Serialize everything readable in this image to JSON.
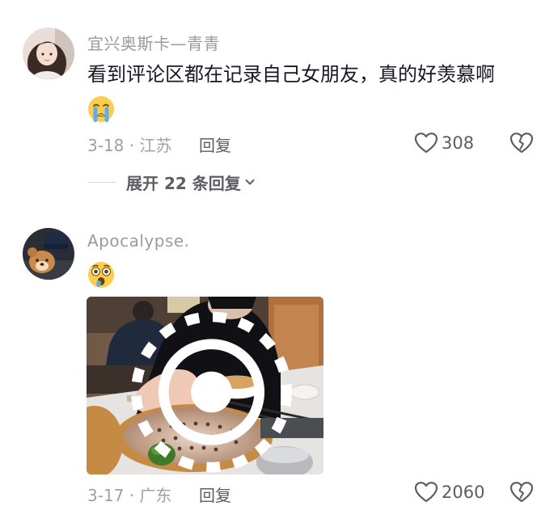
{
  "comments": [
    {
      "username": "宜兴奥斯卡—青青",
      "text": "看到评论区都在记录自己女朋友，真的好羡慕啊",
      "emoji": "loudly-crying-face",
      "date_location": "3-18 · 江苏",
      "reply_label": "回复",
      "like_count": "308",
      "expand_replies": "展开 22 条回复"
    },
    {
      "username": "Apocalypse.",
      "emoji": "astonished-face",
      "date_location": "3-17 · 广东",
      "reply_label": "回复",
      "like_count": "2060",
      "image": "photo-dumplings-steamer"
    }
  ],
  "colors": {
    "primary_text": "#161823",
    "secondary_text": "#9a9aa0",
    "action_text": "#5c5c63"
  },
  "icons": {
    "like": "heart-outline-icon",
    "dislike": "broken-heart-icon",
    "expand": "chevron-down-icon",
    "live_photo": "live-photo-icon"
  }
}
